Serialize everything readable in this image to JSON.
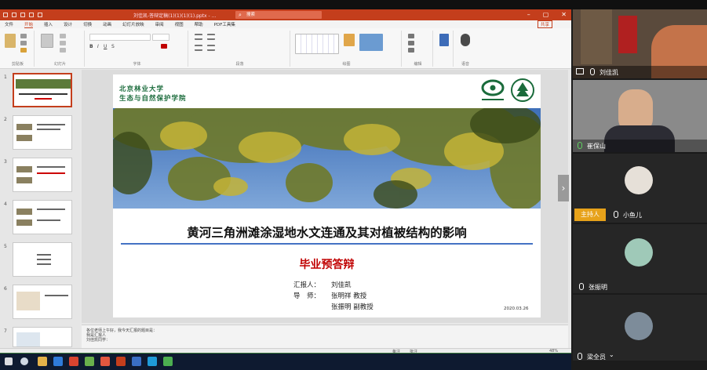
{
  "ppt": {
    "filename": "刘佳凯-答辩定稿(1)(1)(1)(1).pptx - ...",
    "search_label": "搜索",
    "tabs": [
      "文件",
      "开始",
      "插入",
      "设计",
      "切换",
      "动画",
      "幻灯片放映",
      "审阅",
      "视图",
      "帮助",
      "PDF工具集"
    ],
    "active_tab": "开始",
    "share_label": "共享",
    "ribbon_groups": [
      "剪贴板",
      "幻灯片",
      "字体",
      "段落",
      "绘图",
      "编辑",
      "",
      "语音"
    ],
    "notes": [
      "各位老师上午好，我今天汇报的题目是：",
      "我是汇报人",
      "刘佳凯同学："
    ],
    "status_notes": "备注",
    "status_comments": "批注",
    "zoom": "48%"
  },
  "slide": {
    "university": "北京林业大学",
    "school": "生态与自然保护学院",
    "title": "黄河三角洲滩涂湿地水文连通及其对植被结构的影响",
    "subtitle": "毕业预答辩",
    "presenter_label": "汇报人：",
    "presenter": "刘佳凯",
    "advisor_label": "导　师：",
    "advisor1": "张明祥  教授",
    "advisor2": "张振明  副教授",
    "date": "2020.03.26"
  },
  "thumbnails": [
    1,
    2,
    3,
    4,
    5,
    6,
    7
  ],
  "video": {
    "participants": [
      {
        "name": "刘佳凯"
      },
      {
        "name": "崔保山"
      },
      {
        "name": "小鱼儿",
        "badge": "主持人"
      },
      {
        "name": "张振明"
      },
      {
        "name": "梁全员"
      }
    ]
  },
  "colors": {
    "accent": "#c43e1c",
    "title_green": "#1a6b3b",
    "subtitle_red": "#c00000",
    "rule_blue": "#4472c4",
    "host_badge": "#e7a21a"
  }
}
